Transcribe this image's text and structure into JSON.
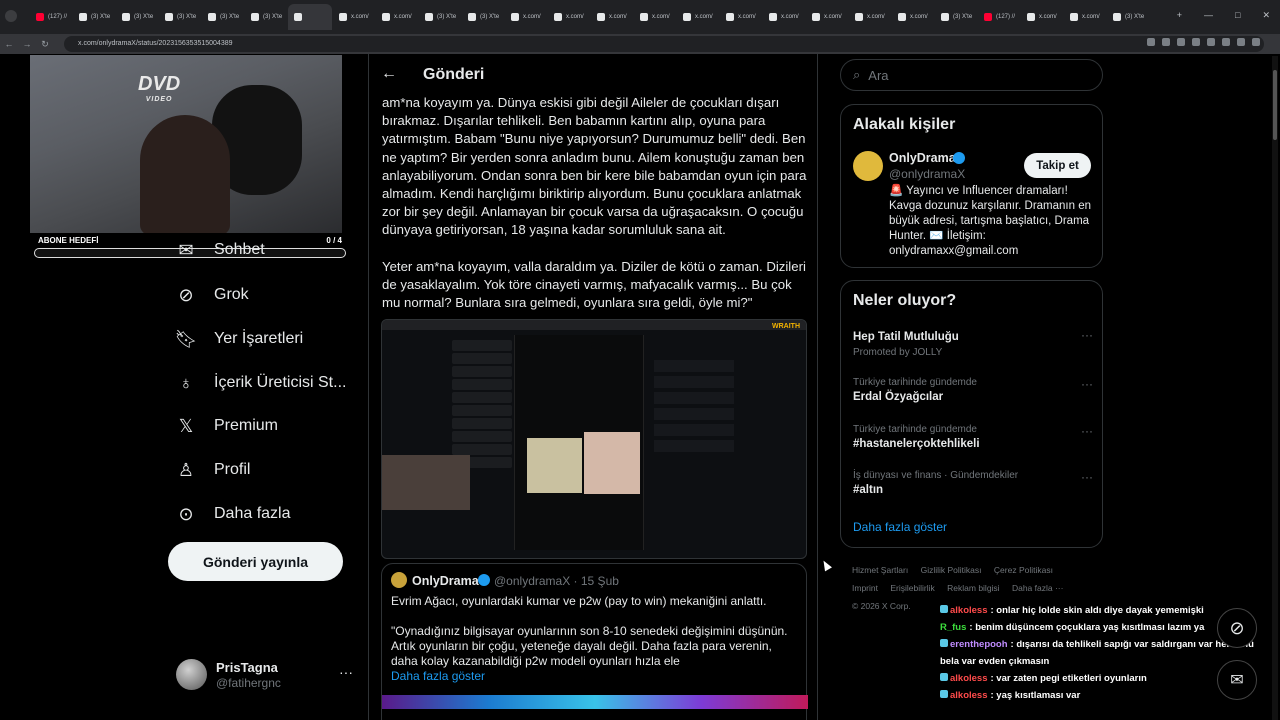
{
  "browser": {
    "tabs": [
      {
        "title": "(127) //",
        "icon_color": "#ff0033"
      },
      {
        "title": "(3) X'te",
        "icon_color": "#e7e9ea"
      },
      {
        "title": "(3) X'te",
        "icon_color": "#e7e9ea"
      },
      {
        "title": "(3) X'te",
        "icon_color": "#e7e9ea"
      },
      {
        "title": "(3) X'te",
        "icon_color": "#e7e9ea"
      },
      {
        "title": "(3) X'te",
        "icon_color": "#e7e9ea"
      },
      {
        "title": "",
        "icon_color": "#e7e9ea",
        "active": true
      },
      {
        "title": "x.com/",
        "icon_color": "#e7e9ea"
      },
      {
        "title": "x.com/",
        "icon_color": "#e7e9ea"
      },
      {
        "title": "(3) X'te",
        "icon_color": "#e7e9ea"
      },
      {
        "title": "(3) X'te",
        "icon_color": "#e7e9ea"
      },
      {
        "title": "x.com/",
        "icon_color": "#e7e9ea"
      },
      {
        "title": "x.com/",
        "icon_color": "#e7e9ea"
      },
      {
        "title": "x.com/",
        "icon_color": "#e7e9ea"
      },
      {
        "title": "x.com/",
        "icon_color": "#e7e9ea"
      },
      {
        "title": "x.com/",
        "icon_color": "#e7e9ea"
      },
      {
        "title": "x.com/",
        "icon_color": "#e7e9ea"
      },
      {
        "title": "x.com/",
        "icon_color": "#e7e9ea"
      },
      {
        "title": "x.com/",
        "icon_color": "#e7e9ea"
      },
      {
        "title": "x.com/",
        "icon_color": "#e7e9ea"
      },
      {
        "title": "x.com/",
        "icon_color": "#e7e9ea"
      },
      {
        "title": "(3) X'te",
        "icon_color": "#e7e9ea"
      },
      {
        "title": "(127) //",
        "icon_color": "#ff0033"
      },
      {
        "title": "x.com/",
        "icon_color": "#e7e9ea"
      },
      {
        "title": "x.com/",
        "icon_color": "#e7e9ea"
      },
      {
        "title": "(3) X'te",
        "icon_color": "#e7e9ea"
      }
    ],
    "url": "x.com/onlydramaX/status/2023156353515004389"
  },
  "stream": {
    "dvd_text": "DVD",
    "dvd_sub": "VIDEO",
    "sub_goal_label": "ABONE HEDEFİ",
    "sub_goal_count": "0 / 4",
    "sub_goal_progress": 0
  },
  "nav": {
    "items": [
      {
        "label": "Sohbet",
        "icon": "envelope-icon"
      },
      {
        "label": "Grok",
        "icon": "grok-icon"
      },
      {
        "label": "Yer İşaretleri",
        "icon": "bookmark-icon"
      },
      {
        "label": "İçerik Üreticisi St...",
        "icon": "creator-studio-icon"
      },
      {
        "label": "Premium",
        "icon": "x-logo-icon"
      },
      {
        "label": "Profil",
        "icon": "person-icon"
      },
      {
        "label": "Daha fazla",
        "icon": "more-circle-icon"
      }
    ],
    "post_button": "Gönderi yayınla"
  },
  "account": {
    "name": "PrisTagna",
    "handle": "@fatihergnc"
  },
  "main": {
    "title": "Gönderi",
    "paragraphs": [
      "am*na koyayım ya. Dünya eskisi gibi değil Aileler de çocukları dışarı bırakmaz. Dışarılar tehlikeli. Ben babamın kartını alıp, oyuna para yatırmıştım. Babam \"Bunu niye yapıyorsun? Durumumuz belli\" dedi. Ben ne yaptım? Bir yerden sonra anladım bunu. Ailem konuştuğu zaman ben anlayabiliyorum. Ondan sonra ben bir kere bile babamdan oyun için para almadım. Kendi harçlığımı biriktirip alıyordum. Bunu çocuklara anlatmak zor bir şey değil. Anlamayan bir çocuk varsa da uğraşacaksın. O çocuğu dünyaya getiriyorsan, 18 yaşına kadar sorumluluk sana ait.",
      "Yeter am*na koyayım, valla daraldım ya. Diziler de kötü o zaman. Dizileri de yasaklayalım. Yok töre cinayeti varmış, mafyacalık varmış... Bu çok mu normal? Bunlara sıra gelmedi, oyunlara sıra geldi, öyle mi?\""
    ],
    "media_label": "WRAITH",
    "quote": {
      "name": "OnlyDrama",
      "handle": "@onlydramaX · 15 Şub",
      "text1": "Evrim Ağacı, oyunlardaki kumar ve p2w (pay to win) mekaniğini anlattı.",
      "text2": "\"Oynadığınız bilgisayar oyunlarının son 8-10 senedeki değişimini düşünün. Artık oyunların bir çoğu, yeteneğe dayalı değil. Daha fazla para verenin, daha kolay kazanabildiği p2w modeli oyunları hızla ele",
      "more": "Daha fazla göster"
    }
  },
  "search": {
    "placeholder": "Ara"
  },
  "who_to_follow": {
    "title": "Alakalı kişiler",
    "name": "OnlyDrama",
    "handle": "@onlydramaX",
    "follow": "Takip et",
    "bio": "🚨 Yayıncı ve Influencer dramaları! Kavga dozunuz karşılanır. Dramanın en büyük adresi, tartışma başlatıcı, Drama Hunter. ✉️ İletişim: onlydramaxx@gmail.com"
  },
  "trends": {
    "title": "Neler oluyor?",
    "items": [
      {
        "meta": "",
        "name": "Hep Tatil Mutluluğu",
        "promo": "Promoted by JOLLY"
      },
      {
        "meta": "Türkiye tarihinde gündemde",
        "name": "Erdal Özyağcılar",
        "promo": ""
      },
      {
        "meta": "Türkiye tarihinde gündemde",
        "name": "#hastanelerçoktehlikeli",
        "promo": ""
      },
      {
        "meta": "İş dünyası ve finans · Gündemdekiler",
        "name": "#altın",
        "promo": ""
      }
    ],
    "show_more": "Daha fazla göster"
  },
  "footer": {
    "links": [
      "Hizmet Şartları",
      "Gizlilik Politikası",
      "Çerez Politikası",
      "Imprint",
      "Erişilebilirlik",
      "Reklam bilgisi",
      "Daha fazla ···"
    ],
    "copyright": "© 2026 X Corp."
  },
  "chat": [
    {
      "user": "alkoless",
      "color": "#ff4b4b",
      "msg": ": onlar hiç lolde skin aldı diye dayak yememişki",
      "badge": true
    },
    {
      "user": "R_fus",
      "color": "#3cdc3c",
      "msg": ": benim düşüncem çoçuklara yaş kısıtlması lazım ya",
      "badge": false
    },
    {
      "user": "erenthepooh",
      "color": "#c08cff",
      "msg": ": dışarısı da tehlikeli sapığı var saldırganı var her türlü bela var evden çıkmasın",
      "badge": true
    },
    {
      "user": "alkoless",
      "color": "#ff4b4b",
      "msg": ": var zaten pegi etiketleri oyunların",
      "badge": true
    },
    {
      "user": "alkoless",
      "color": "#ff4b4b",
      "msg": ": yaş kısıtlaması var",
      "badge": true
    }
  ]
}
